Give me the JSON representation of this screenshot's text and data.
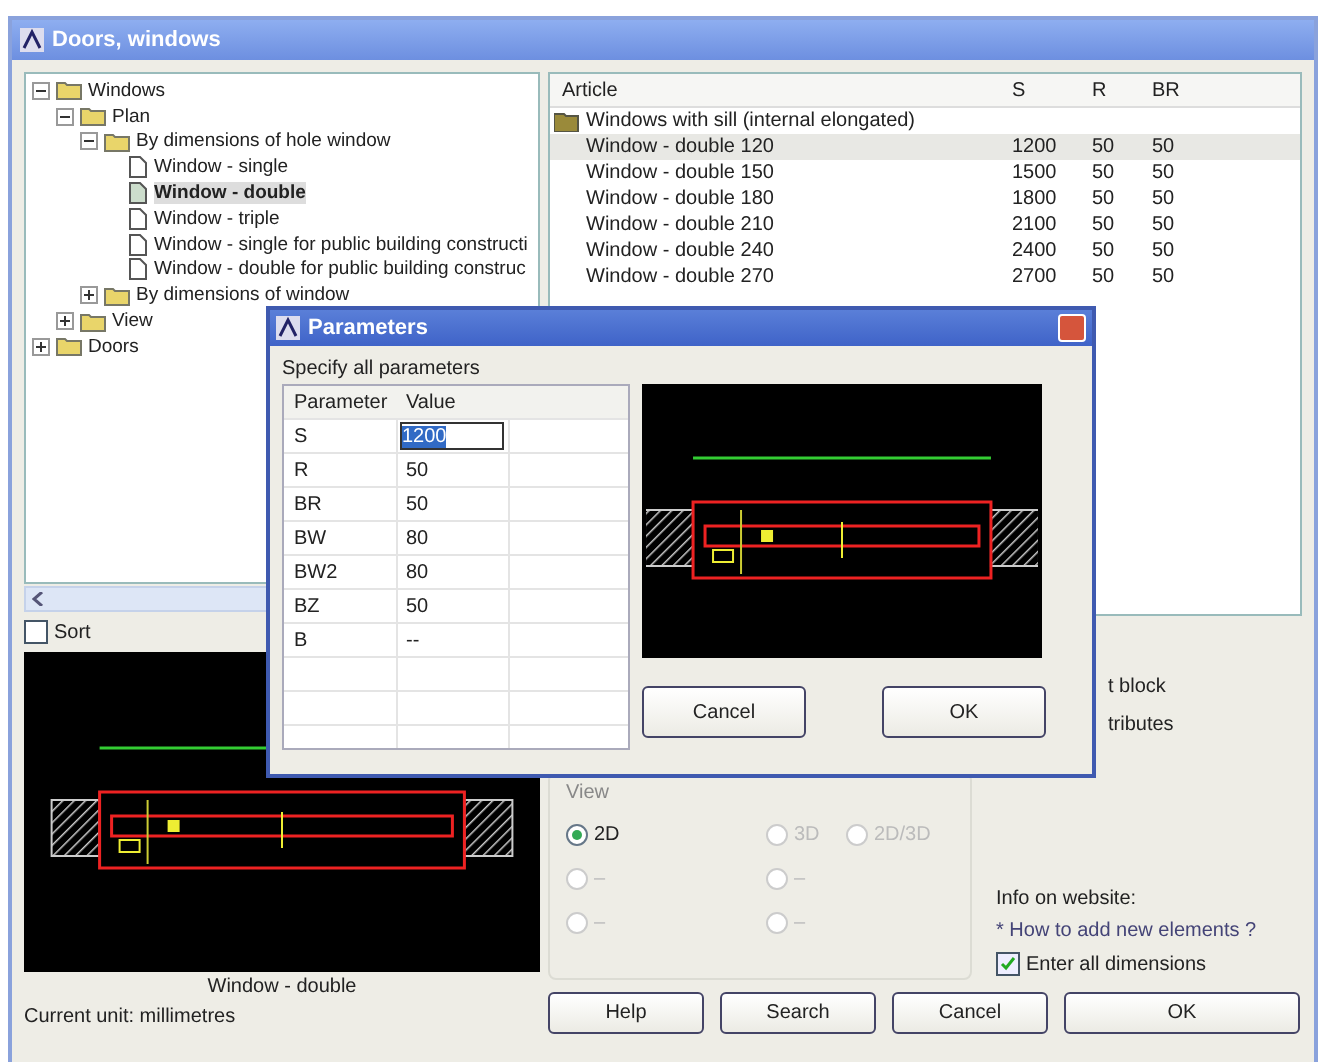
{
  "window": {
    "title": "Doors, windows"
  },
  "tree": [
    {
      "label": "Windows",
      "kind": "folder",
      "expanded": true,
      "children": [
        {
          "label": "Plan",
          "kind": "folder",
          "expanded": true,
          "children": [
            {
              "label": "By dimensions of hole window",
              "kind": "folder",
              "expanded": true,
              "children": [
                {
                  "label": "Window - single",
                  "kind": "doc",
                  "selected": false
                },
                {
                  "label": "Window - double",
                  "kind": "doc",
                  "selected": true
                },
                {
                  "label": "Window - triple",
                  "kind": "doc",
                  "selected": false
                },
                {
                  "label": "Window - single for public building constructi",
                  "kind": "doc",
                  "selected": false
                },
                {
                  "label": "Window - double for public building construc",
                  "kind": "doc",
                  "selected": false
                }
              ]
            },
            {
              "label": "By dimensions of window",
              "kind": "folder",
              "expanded": false
            }
          ]
        },
        {
          "label": "View",
          "kind": "folder",
          "expanded": false
        }
      ]
    },
    {
      "label": "Doors",
      "kind": "folder",
      "expanded": false
    }
  ],
  "sort": {
    "label": "Sort",
    "checked": false
  },
  "preview": {
    "caption": "Window - double"
  },
  "unit": "Current unit: millimetres",
  "list": {
    "columns": [
      "Article",
      "S",
      "R",
      "BR"
    ],
    "group": "Windows with sill (internal elongated)",
    "rows": [
      {
        "cells": [
          "Window - double 120",
          "1200",
          "50",
          "50"
        ],
        "selected": true
      },
      {
        "cells": [
          "Window - double 150",
          "1500",
          "50",
          "50"
        ],
        "selected": false
      },
      {
        "cells": [
          "Window - double 180",
          "1800",
          "50",
          "50"
        ],
        "selected": false
      },
      {
        "cells": [
          "Window - double 210",
          "2100",
          "50",
          "50"
        ],
        "selected": false
      },
      {
        "cells": [
          "Window - double 240",
          "2400",
          "50",
          "50"
        ],
        "selected": false
      },
      {
        "cells": [
          "Window - double 270",
          "2700",
          "50",
          "50"
        ],
        "selected": false
      }
    ]
  },
  "options": [
    "t block",
    "tributes"
  ],
  "view": {
    "label": "View",
    "radios": [
      {
        "label": "2D",
        "selected": true,
        "disabled": false
      },
      {
        "label": "3D",
        "selected": false,
        "disabled": true
      },
      {
        "label": "2D/3D",
        "selected": false,
        "disabled": true
      },
      {
        "label": "–",
        "selected": false,
        "disabled": true
      },
      {
        "label": "–",
        "selected": false,
        "disabled": true
      },
      {
        "label": "–",
        "selected": false,
        "disabled": true
      },
      {
        "label": "–",
        "selected": false,
        "disabled": true
      }
    ]
  },
  "info": {
    "label": "Info on website:",
    "link": "* How to add new elements ?"
  },
  "enter_all": {
    "label": "Enter all dimensions",
    "checked": true
  },
  "buttons": [
    "Help",
    "Search",
    "Cancel",
    "OK"
  ],
  "dialog": {
    "title": "Parameters",
    "prompt": "Specify all parameters",
    "columns": [
      "Parameter",
      "Value"
    ],
    "rows": [
      {
        "name": "S",
        "value": "1200",
        "editing": true
      },
      {
        "name": "R",
        "value": "50",
        "editing": false
      },
      {
        "name": "BR",
        "value": "50",
        "editing": false
      },
      {
        "name": "BW",
        "value": "80",
        "editing": false
      },
      {
        "name": "BW2",
        "value": "80",
        "editing": false
      },
      {
        "name": "BZ",
        "value": "50",
        "editing": false
      },
      {
        "name": "B",
        "value": "--",
        "editing": false
      }
    ],
    "buttons": [
      "Cancel",
      "OK"
    ]
  }
}
